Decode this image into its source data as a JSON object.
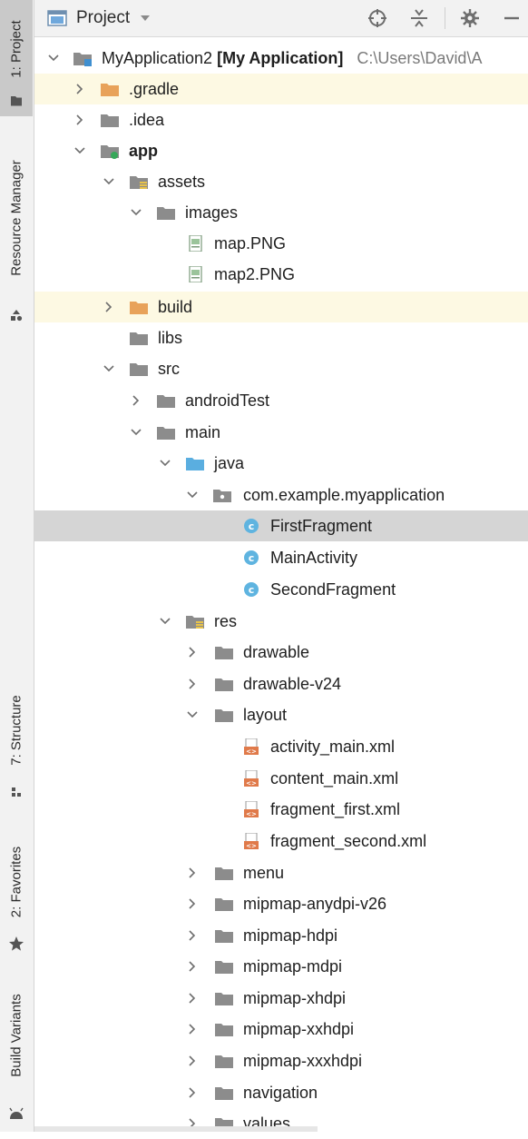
{
  "sidebar": {
    "tabs": [
      {
        "label": "1: Project",
        "icon": "folder-icon",
        "active": true
      },
      {
        "label": "Resource Manager",
        "icon": "resource-manager-icon",
        "active": false
      },
      {
        "label": "7: Structure",
        "icon": "structure-icon",
        "active": false
      },
      {
        "label": "2: Favorites",
        "icon": "star-icon",
        "active": false
      },
      {
        "label": "Build Variants",
        "icon": "android-icon",
        "active": false
      }
    ]
  },
  "toolbar": {
    "title": "Project",
    "icons": [
      "project-view-icon",
      "chevron-down-icon",
      "locate-icon",
      "collapse-all-icon",
      "gear-icon",
      "minimize-icon"
    ]
  },
  "colors": {
    "folder": "#8c8c8c",
    "excluded_folder": "#e8a25a",
    "source_folder": "#5aaee0",
    "class_icon": "#5fb4e0",
    "xml_icon": "#e07a4a",
    "selection": "#d5d5d5",
    "excluded_row": "#fdf9e3"
  },
  "tree": {
    "root": {
      "name": "MyApplication2",
      "module": "[My Application]",
      "path": "C:\\Users\\David\\A"
    },
    "gradle": ".gradle",
    "idea": ".idea",
    "app": "app",
    "assets": "assets",
    "images": "images",
    "map": "map.PNG",
    "map2": "map2.PNG",
    "build": "build",
    "libs": "libs",
    "src": "src",
    "androidTest": "androidTest",
    "main": "main",
    "java": "java",
    "package": "com.example.myapplication",
    "firstFragment": "FirstFragment",
    "mainActivity": "MainActivity",
    "secondFragment": "SecondFragment",
    "res": "res",
    "drawable": "drawable",
    "drawable_v24": "drawable-v24",
    "layout": "layout",
    "activity_main": "activity_main.xml",
    "content_main": "content_main.xml",
    "fragment_first": "fragment_first.xml",
    "fragment_second": "fragment_second.xml",
    "menu": "menu",
    "mipmap_anydpi": "mipmap-anydpi-v26",
    "mipmap_hdpi": "mipmap-hdpi",
    "mipmap_mdpi": "mipmap-mdpi",
    "mipmap_xhdpi": "mipmap-xhdpi",
    "mipmap_xxhdpi": "mipmap-xxhdpi",
    "mipmap_xxxhdpi": "mipmap-xxxhdpi",
    "navigation": "navigation",
    "values": "values"
  }
}
